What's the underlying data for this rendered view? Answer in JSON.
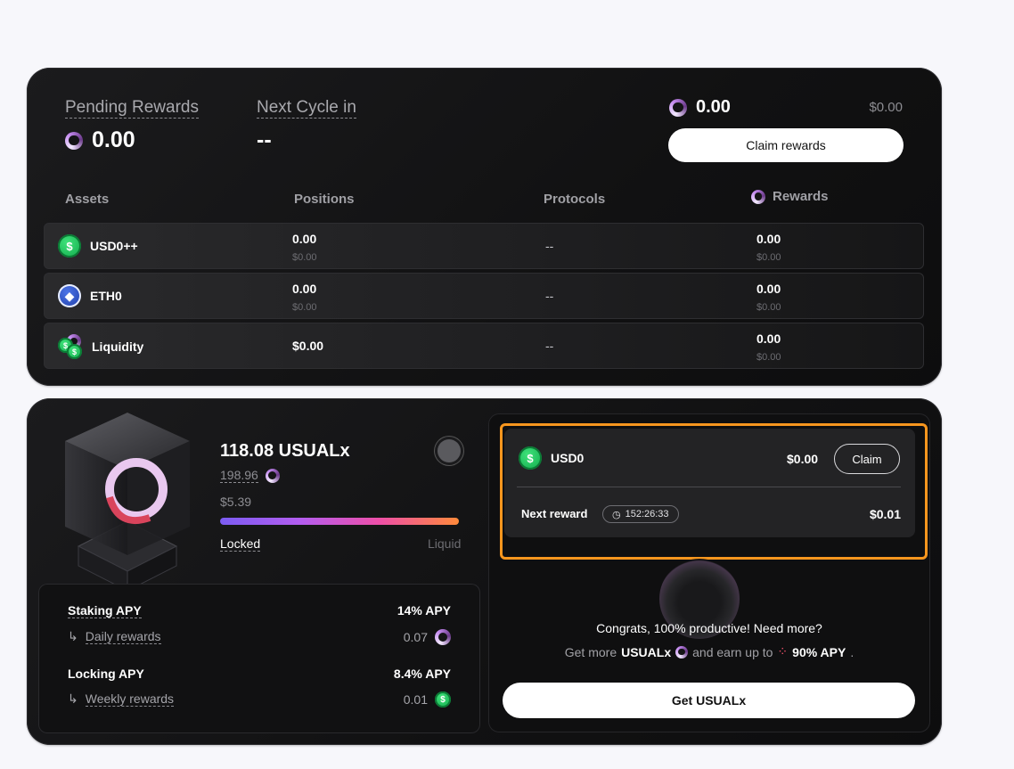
{
  "summary": {
    "pending_rewards_label": "Pending Rewards",
    "pending_rewards_value": "0.00",
    "next_cycle_label": "Next Cycle in",
    "next_cycle_value": "--",
    "claimable_amount": "0.00",
    "claimable_usd": "$0.00",
    "claim_button": "Claim rewards"
  },
  "table": {
    "headers": {
      "assets": "Assets",
      "positions": "Positions",
      "protocols": "Protocols",
      "rewards": "Rewards"
    },
    "rows": [
      {
        "asset": "USD0++",
        "icon": "usd-coin-icon",
        "position": "0.00",
        "position_usd": "$0.00",
        "protocols": "--",
        "reward": "0.00",
        "reward_usd": "$0.00"
      },
      {
        "asset": "ETH0",
        "icon": "eth-coin-icon",
        "position": "0.00",
        "position_usd": "$0.00",
        "protocols": "--",
        "reward": "0.00",
        "reward_usd": "$0.00"
      },
      {
        "asset": "Liquidity",
        "icon": "liquidity-icon",
        "position": "$0.00",
        "protocols": "--",
        "reward": "0.00",
        "reward_usd": "$0.00"
      }
    ]
  },
  "staking": {
    "amount": "118.08 USUALx",
    "sub_amount": "198.96",
    "usd_value": "$5.39",
    "locked_label": "Locked",
    "liquid_label": "Liquid"
  },
  "apy": {
    "staking_label": "Staking APY",
    "staking_value": "14% APY",
    "daily_label": "Daily rewards",
    "daily_value": "0.07",
    "locking_label": "Locking APY",
    "locking_value": "8.4% APY",
    "weekly_label": "Weekly rewards",
    "weekly_value": "0.01"
  },
  "usd0_reward": {
    "token": "USD0",
    "value": "$0.00",
    "claim_button": "Claim",
    "next_reward_label": "Next reward",
    "timer": "152:26:33",
    "next_reward_value": "$0.01"
  },
  "promo": {
    "congrats": "Congrats, 100% productive! Need more?",
    "get_more": "Get more",
    "token": "USUALx",
    "earn_up_to": "and earn up to",
    "apy": "90% APY",
    "period": ".",
    "button": "Get USUALx"
  },
  "colors": {
    "accent_highlight": "#f7961e",
    "progress_start": "#7b5cf2",
    "progress_end": "#ff8a3a"
  }
}
